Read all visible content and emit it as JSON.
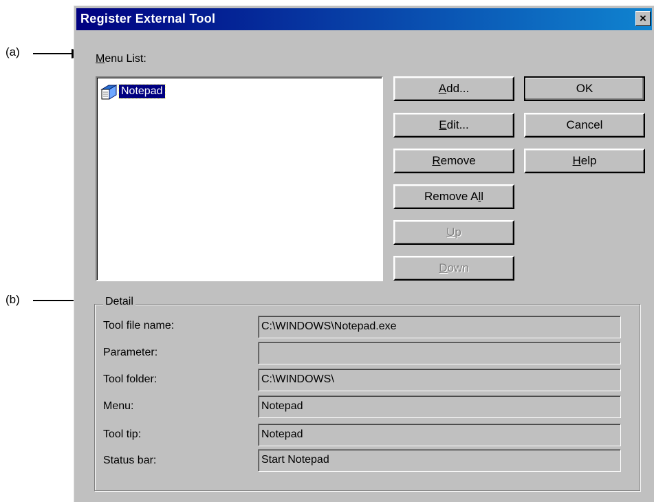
{
  "callouts": {
    "a": "(a)",
    "b": "(b)"
  },
  "dialog": {
    "title": "Register External Tool",
    "close_symbol": "×",
    "menu_list": {
      "label_mnemonic": "M",
      "label_rest": "enu List:",
      "items": [
        {
          "label": "Notepad",
          "icon": "notepad-icon",
          "selected": true
        }
      ]
    },
    "buttons": {
      "add": {
        "mn": "A",
        "rest": "dd..."
      },
      "edit": {
        "mn": "E",
        "rest": "dit..."
      },
      "remove": {
        "mn": "R",
        "rest": "emove"
      },
      "remove_all": {
        "pre": "Remove A",
        "mn": "l",
        "rest": "l"
      },
      "up": {
        "mn": "U",
        "rest": "p",
        "disabled": true
      },
      "down": {
        "mn": "D",
        "rest": "own",
        "disabled": true
      },
      "ok": "OK",
      "cancel": "Cancel",
      "help": {
        "mn": "H",
        "rest": "elp"
      }
    },
    "detail": {
      "title": "Detail",
      "fields": [
        {
          "label": "Tool file name:",
          "value": "C:\\WINDOWS\\Notepad.exe"
        },
        {
          "label": "Parameter:",
          "value": ""
        },
        {
          "label": "Tool folder:",
          "value": "C:\\WINDOWS\\"
        },
        {
          "label": "Menu:",
          "value": "Notepad"
        },
        {
          "label": "Tool tip:",
          "value": "Notepad"
        },
        {
          "label": "Status bar:",
          "value": "Start Notepad"
        }
      ]
    }
  },
  "colors": {
    "face": "#c0c0c0",
    "titlebar_start": "#000080",
    "titlebar_end": "#1084d0",
    "selection": "#000080"
  }
}
